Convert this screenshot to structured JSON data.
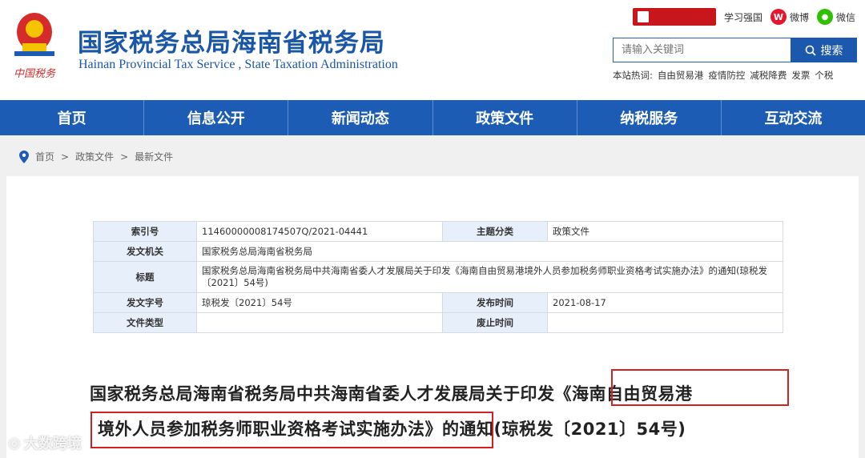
{
  "header": {
    "title": "国家税务总局海南省税务局",
    "subtitle": "Hainan  Provincial  Tax  Service , State  Taxation  Administration",
    "emblem_text": "中国税务",
    "badge_label": "学习强国",
    "top_links": [
      "学习强国",
      "微博",
      "微信"
    ]
  },
  "search": {
    "placeholder": "请输入关键词",
    "button_label": "搜索",
    "hot_label": "本站热词:",
    "hot_words": [
      "自由贸易港",
      "疫情防控",
      "减税降费",
      "发票",
      "个税"
    ]
  },
  "nav": {
    "items": [
      "首页",
      "信息公开",
      "新闻动态",
      "政策文件",
      "纳税服务",
      "互动交流"
    ]
  },
  "breadcrumb": [
    "首页",
    "政策文件",
    "最新文件"
  ],
  "meta_table": {
    "index_label": "索引号",
    "index_value": "11460000008174507Q/2021-04441",
    "category_label": "主题分类",
    "category_value": "政策文件",
    "issuer_label": "发文机关",
    "issuer_value": "国家税务总局海南省税务局",
    "title_label": "标题",
    "title_value": "国家税务总局海南省税务局中共海南省委人才发展局关于印发《海南自由贸易港境外人员参加税务师职业资格考试实施办法》的通知(琼税发〔2021〕54号)",
    "docno_label": "发文字号",
    "docno_value": "琼税发〔2021〕54号",
    "publish_label": "发布时间",
    "publish_value": "2021-08-17",
    "doctype_label": "文件类型",
    "doctype_value": "",
    "expire_label": "废止时间",
    "expire_value": ""
  },
  "document": {
    "title_line1": "国家税务总局海南省税务局中共海南省委人才发展局关于印发《海南自由贸易港",
    "title_line2": "境外人员参加税务师职业资格考试实施办法》的通知(琼税发〔2021〕54号)"
  },
  "watermark": "大数跨境",
  "colors": {
    "brand_blue": "#1c5cb5",
    "highlight_red": "#d42020",
    "table_key_bg": "#e6effa"
  }
}
